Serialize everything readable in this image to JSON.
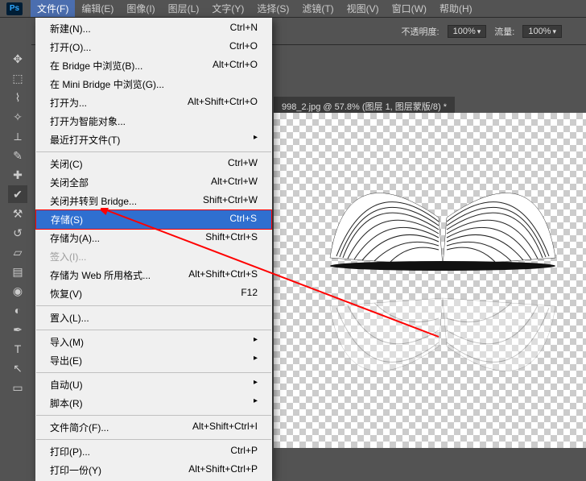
{
  "app": {
    "name": "Ps"
  },
  "menubar": [
    {
      "id": "file",
      "label": "文件(F)"
    },
    {
      "id": "edit",
      "label": "编辑(E)"
    },
    {
      "id": "image",
      "label": "图像(I)"
    },
    {
      "id": "layer",
      "label": "图层(L)"
    },
    {
      "id": "type",
      "label": "文字(Y)"
    },
    {
      "id": "select",
      "label": "选择(S)"
    },
    {
      "id": "filter",
      "label": "滤镜(T)"
    },
    {
      "id": "view",
      "label": "视图(V)"
    },
    {
      "id": "window",
      "label": "窗口(W)"
    },
    {
      "id": "help",
      "label": "帮助(H)"
    }
  ],
  "opts": {
    "opacity_label": "不透明度:",
    "opacity_value": "100%",
    "flow_label": "流量:",
    "flow_value": "100%"
  },
  "doc_tab": "998_2.jpg @ 57.8% (图层 1, 图层蒙版/8) *",
  "file_menu": [
    {
      "label": "新建(N)...",
      "shortcut": "Ctrl+N"
    },
    {
      "label": "打开(O)...",
      "shortcut": "Ctrl+O"
    },
    {
      "label": "在 Bridge 中浏览(B)...",
      "shortcut": "Alt+Ctrl+O"
    },
    {
      "label": "在 Mini Bridge 中浏览(G)...",
      "shortcut": ""
    },
    {
      "label": "打开为...",
      "shortcut": "Alt+Shift+Ctrl+O"
    },
    {
      "label": "打开为智能对象...",
      "shortcut": ""
    },
    {
      "label": "最近打开文件(T)",
      "shortcut": "",
      "sub": true
    },
    {
      "sep": true
    },
    {
      "label": "关闭(C)",
      "shortcut": "Ctrl+W"
    },
    {
      "label": "关闭全部",
      "shortcut": "Alt+Ctrl+W"
    },
    {
      "label": "关闭并转到 Bridge...",
      "shortcut": "Shift+Ctrl+W"
    },
    {
      "label": "存储(S)",
      "shortcut": "Ctrl+S",
      "hl": true
    },
    {
      "label": "存储为(A)...",
      "shortcut": "Shift+Ctrl+S"
    },
    {
      "label": "签入(I)...",
      "shortcut": "",
      "dis": true
    },
    {
      "label": "存储为 Web 所用格式...",
      "shortcut": "Alt+Shift+Ctrl+S"
    },
    {
      "label": "恢复(V)",
      "shortcut": "F12"
    },
    {
      "sep": true
    },
    {
      "label": "置入(L)...",
      "shortcut": ""
    },
    {
      "sep": true
    },
    {
      "label": "导入(M)",
      "shortcut": "",
      "sub": true
    },
    {
      "label": "导出(E)",
      "shortcut": "",
      "sub": true
    },
    {
      "sep": true
    },
    {
      "label": "自动(U)",
      "shortcut": "",
      "sub": true
    },
    {
      "label": "脚本(R)",
      "shortcut": "",
      "sub": true
    },
    {
      "sep": true
    },
    {
      "label": "文件简介(F)...",
      "shortcut": "Alt+Shift+Ctrl+I"
    },
    {
      "sep": true
    },
    {
      "label": "打印(P)...",
      "shortcut": "Ctrl+P"
    },
    {
      "label": "打印一份(Y)",
      "shortcut": "Alt+Shift+Ctrl+P"
    }
  ],
  "tools": [
    {
      "name": "move",
      "glyph": "✥"
    },
    {
      "name": "marquee",
      "glyph": "⬚"
    },
    {
      "name": "lasso",
      "glyph": "⌇"
    },
    {
      "name": "wand",
      "glyph": "✧"
    },
    {
      "name": "crop",
      "glyph": "⟂"
    },
    {
      "name": "eyedrop",
      "glyph": "✎"
    },
    {
      "name": "heal",
      "glyph": "✚"
    },
    {
      "name": "brush",
      "glyph": "✔"
    },
    {
      "name": "stamp",
      "glyph": "⚒"
    },
    {
      "name": "history",
      "glyph": "↺"
    },
    {
      "name": "eraser",
      "glyph": "▱"
    },
    {
      "name": "gradient",
      "glyph": "▤"
    },
    {
      "name": "blur",
      "glyph": "◉"
    },
    {
      "name": "dodge",
      "glyph": "◐"
    },
    {
      "name": "pen",
      "glyph": "✒"
    },
    {
      "name": "type",
      "glyph": "T"
    },
    {
      "name": "path",
      "glyph": "↖"
    },
    {
      "name": "shape",
      "glyph": "▭"
    }
  ]
}
